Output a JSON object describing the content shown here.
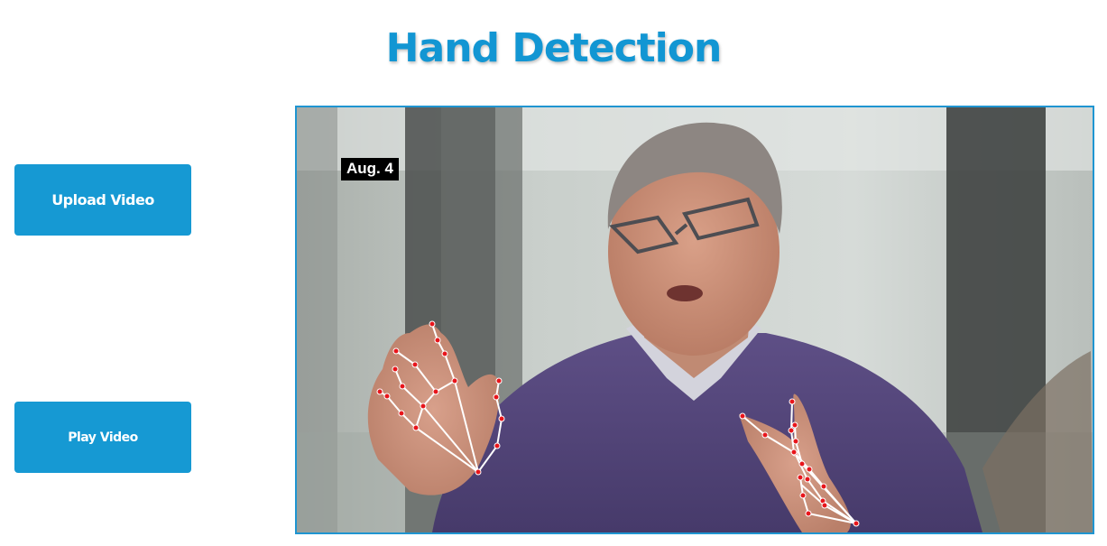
{
  "header": {
    "title": "Hand Detection"
  },
  "controls": {
    "upload_label": "Upload Video",
    "play_label": "Play Video"
  },
  "video": {
    "caption": "Aug. 4"
  },
  "colors": {
    "accent": "#1699d3",
    "landmark_point": "#e8151b",
    "landmark_line": "#ffffff"
  }
}
